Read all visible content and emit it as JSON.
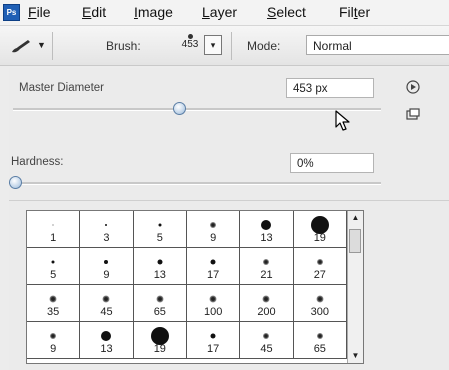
{
  "menubar": {
    "items": [
      "File",
      "Edit",
      "Image",
      "Layer",
      "Select",
      "Filter"
    ],
    "underline": [
      "F",
      "E",
      "I",
      "L",
      "S",
      "t"
    ]
  },
  "options": {
    "brush_label": "Brush:",
    "brush_size": "453",
    "mode_label": "Mode:",
    "mode_value": "Normal"
  },
  "panel": {
    "master_diameter_label": "Master Diameter",
    "master_diameter_value": "453 px",
    "master_diameter_level": 0.45,
    "hardness_label": "Hardness:",
    "hardness_value": "0%",
    "hardness_level": 0.0
  },
  "presets": [
    {
      "size": "1",
      "dot": 1
    },
    {
      "size": "3",
      "dot": 2
    },
    {
      "size": "5",
      "dot": 3
    },
    {
      "size": "9",
      "dot": 6
    },
    {
      "size": "13",
      "dot": 10
    },
    {
      "size": "19",
      "dot": 18
    },
    {
      "size": "5",
      "dot": 3
    },
    {
      "size": "9",
      "dot": 4
    },
    {
      "size": "13",
      "dot": 5
    },
    {
      "size": "17",
      "dot": 5
    },
    {
      "size": "21",
      "dot": 6
    },
    {
      "size": "27",
      "dot": 6
    },
    {
      "size": "35",
      "dot": 7
    },
    {
      "size": "45",
      "dot": 7
    },
    {
      "size": "65",
      "dot": 7
    },
    {
      "size": "100",
      "dot": 7
    },
    {
      "size": "200",
      "dot": 7
    },
    {
      "size": "300",
      "dot": 7
    },
    {
      "size": "9",
      "dot": 6
    },
    {
      "size": "13",
      "dot": 10
    },
    {
      "size": "19",
      "dot": 18
    },
    {
      "size": "17",
      "dot": 5
    },
    {
      "size": "45",
      "dot": 6
    },
    {
      "size": "65",
      "dot": 6
    }
  ],
  "colors": {
    "accent": "#1f5fb5",
    "knob": "#b9cfe6"
  },
  "icons": {
    "logo": "photoshop-logo-icon",
    "tool": "brush-tool-icon",
    "panel_menu": "panel-menu-icon",
    "new_preset": "new-preset-icon",
    "cursor": "mouse-pointer-icon"
  }
}
